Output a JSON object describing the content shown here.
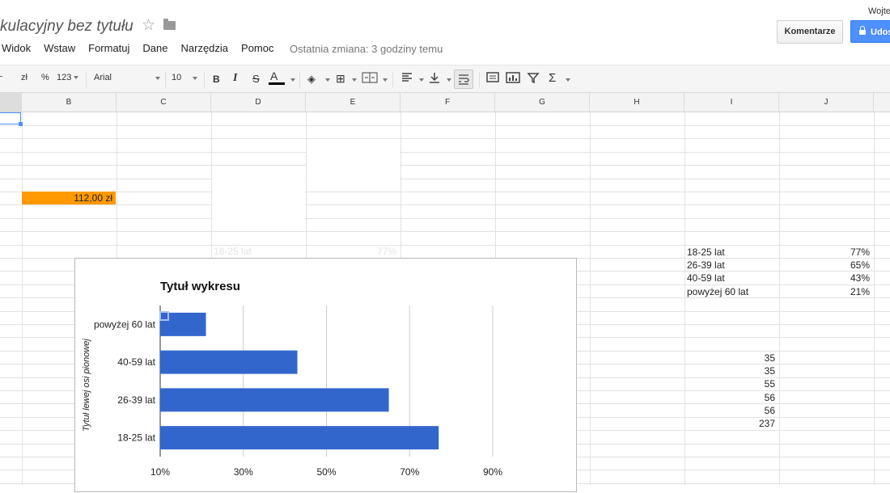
{
  "header": {
    "doc_title": "kulacyjny bez tytułu",
    "star_icon": "star-outline-icon",
    "folder_icon": "folder-icon",
    "user_name": "Wojte",
    "comments_label": "Komentarze",
    "share_label": "Udos",
    "share_icon": "lock-icon"
  },
  "menu": {
    "items": [
      "Widok",
      "Wstaw",
      "Formatuj",
      "Dane",
      "Narzędzia",
      "Pomoc"
    ],
    "last_change": "Ostatnia zmiana: 3 godziny temu"
  },
  "toolbar": {
    "currency": "zł",
    "percent": "%",
    "number_format": "123",
    "font": "Arial",
    "font_size": "10",
    "bold": "B",
    "italic": "I",
    "strike": "S",
    "text_color": "A",
    "sum": "Σ"
  },
  "grid": {
    "columns": [
      "B",
      "C",
      "D",
      "E",
      "F",
      "G",
      "H",
      "I",
      "J"
    ],
    "b9_value": "112,00 zł",
    "d_ghost_label": "18-25 lat",
    "e_ghost_value": "77%",
    "i_labels": [
      "18-25 lat",
      "26-39 lat",
      "40-59 lat",
      "powyżej 60 lat"
    ],
    "j_values": [
      "77%",
      "65%",
      "43%",
      "21%"
    ],
    "i_numbers": [
      "35",
      "35",
      "55",
      "56",
      "56",
      "237"
    ],
    "accent_color": "#ff9900",
    "selection_color": "#4d90fe"
  },
  "chart_data": {
    "type": "bar",
    "orientation": "horizontal",
    "title": "Tytuł wykresu",
    "ylabel": "Tytuł lewej osi pionowej",
    "xlabel": "",
    "categories": [
      "powyżej 60 lat",
      "40-59 lat",
      "26-39 lat",
      "18-25 lat"
    ],
    "values": [
      21,
      43,
      65,
      77
    ],
    "x_unit": "%",
    "xlim": [
      10,
      90
    ],
    "x_ticks": [
      "10%",
      "30%",
      "50%",
      "70%",
      "90%"
    ],
    "x_tick_values": [
      10,
      30,
      50,
      70,
      90
    ],
    "bar_color": "#3366cc",
    "grid": true
  }
}
